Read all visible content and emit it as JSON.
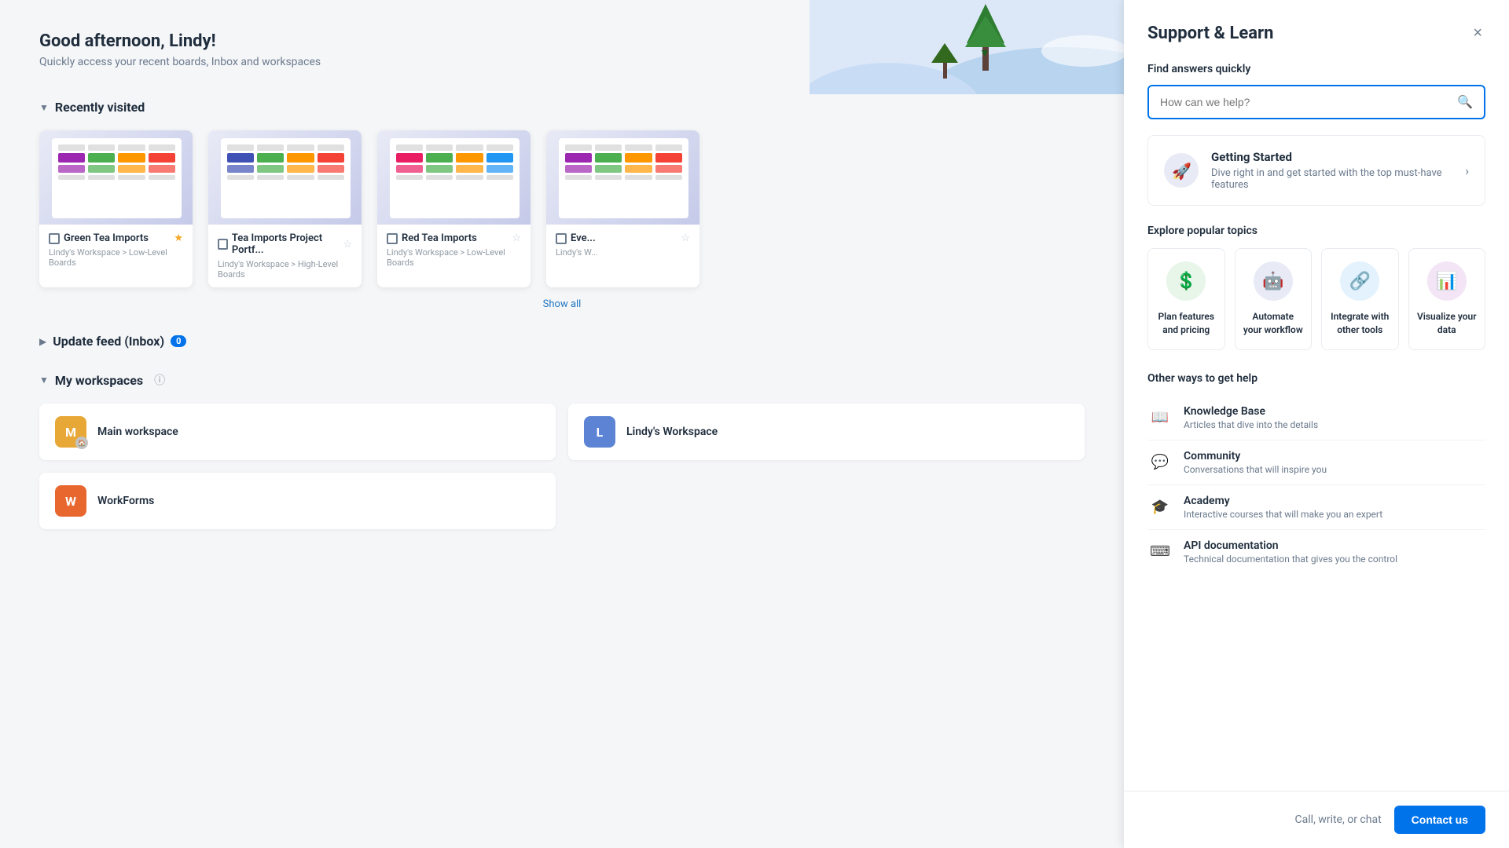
{
  "greeting": {
    "title": "Good afternoon, Lindy!",
    "subtitle": "Quickly access your recent boards, Inbox and workspaces"
  },
  "recently_visited": {
    "section_label": "Recently visited",
    "show_all_label": "Show all",
    "boards": [
      {
        "name": "Green Tea Imports",
        "path": "Lindy's Workspace > Low-Level Boards",
        "starred": true,
        "icon": "board"
      },
      {
        "name": "Tea Imports Project Portf...",
        "path": "Lindy's Workspace > High-Level Boards",
        "starred": false,
        "icon": "board"
      },
      {
        "name": "Red Tea Imports",
        "path": "Lindy's Workspace > Low-Level Boards",
        "starred": false,
        "icon": "board"
      },
      {
        "name": "Eve...",
        "path": "Lindy's W...",
        "starred": false,
        "icon": "board"
      }
    ]
  },
  "update_feed": {
    "section_label": "Update feed (Inbox)",
    "badge": "0"
  },
  "my_workspaces": {
    "section_label": "My workspaces",
    "workspaces": [
      {
        "name": "Main workspace",
        "initial": "M",
        "color": "#e8a838",
        "has_home": true
      },
      {
        "name": "Lindy's Workspace",
        "initial": "L",
        "color": "#5d84d4",
        "has_home": false
      },
      {
        "name": "WorkForms",
        "initial": "W",
        "color": "#e8672f",
        "has_home": false
      }
    ]
  },
  "support_panel": {
    "title": "Support & Learn",
    "close_label": "×",
    "find_answers_label": "Find answers quickly",
    "search_placeholder": "How can we help?",
    "getting_started": {
      "title": "Getting Started",
      "subtitle": "Dive right in and get started with the top must-have features"
    },
    "explore_label": "Explore popular topics",
    "topics": [
      {
        "label": "Plan features and pricing",
        "icon": "dollar-icon",
        "bg": "#e8f5e9",
        "color": "#43a047"
      },
      {
        "label": "Automate your workflow",
        "icon": "robot-icon",
        "bg": "#e8eaf6",
        "color": "#3949ab"
      },
      {
        "label": "Integrate with other tools",
        "icon": "integrate-icon",
        "bg": "#e3f2fd",
        "color": "#1e88e5"
      },
      {
        "label": "Visualize your data",
        "icon": "chart-icon",
        "bg": "#f3e5f5",
        "color": "#8e24aa"
      }
    ],
    "other_ways_label": "Other ways to get help",
    "help_items": [
      {
        "title": "Knowledge Base",
        "desc": "Articles that dive into the details",
        "icon": "📖"
      },
      {
        "title": "Community",
        "desc": "Conversations that will inspire you",
        "icon": "💬"
      },
      {
        "title": "Academy",
        "desc": "Interactive courses that will make you an expert",
        "icon": "🎓"
      },
      {
        "title": "API documentation",
        "desc": "Technical documentation that gives you the control",
        "icon": "⌨"
      }
    ],
    "footer": {
      "call_text": "Call, write, or chat",
      "contact_label": "Contact us"
    }
  }
}
